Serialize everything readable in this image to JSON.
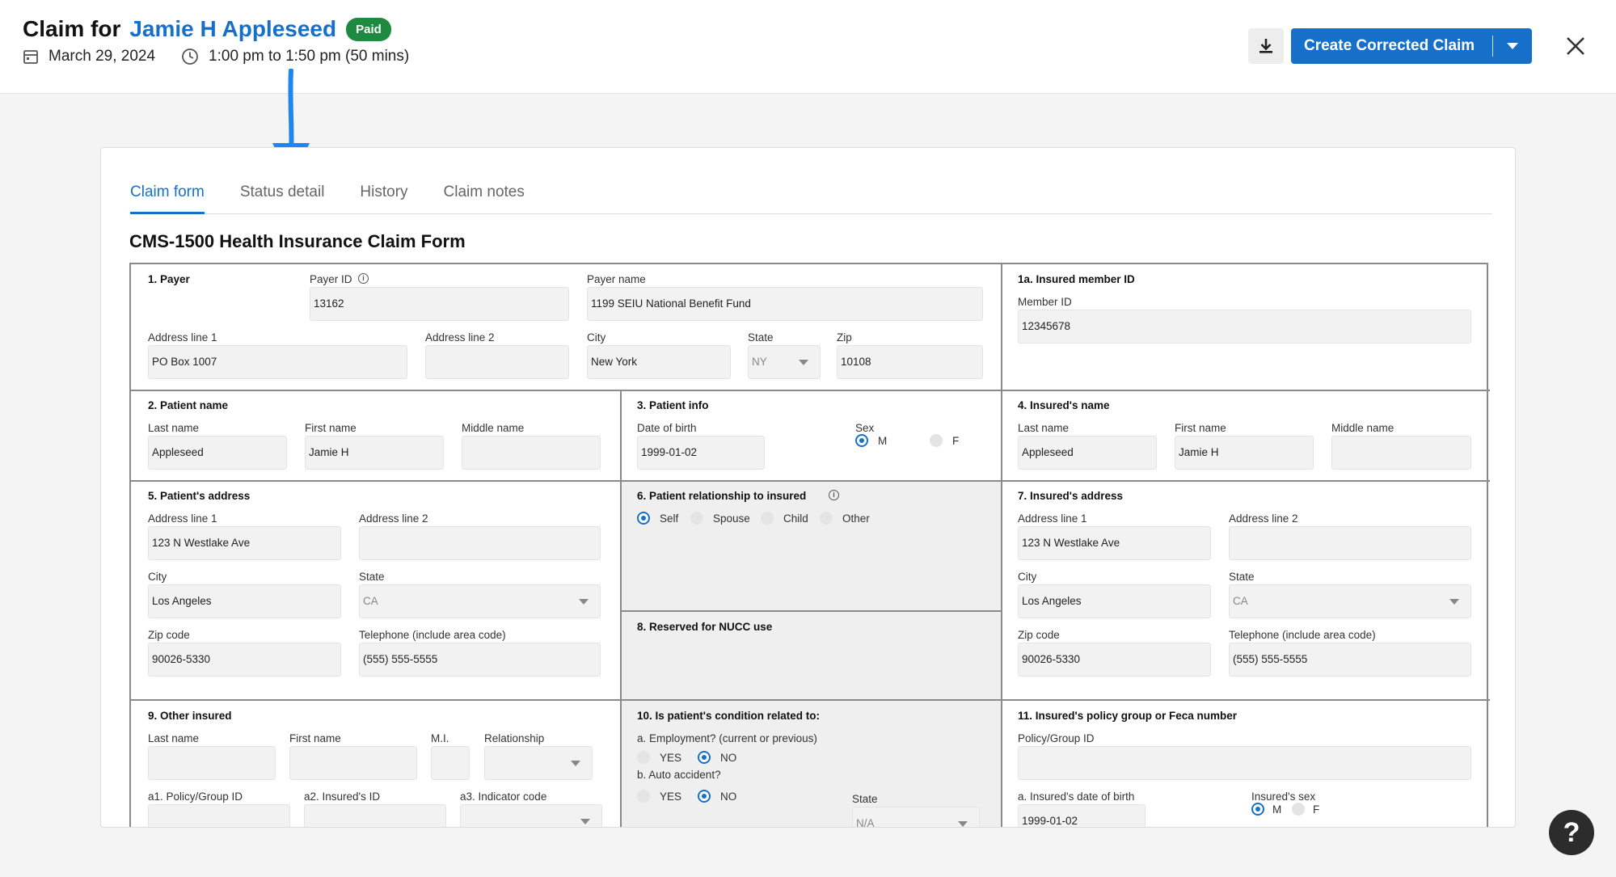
{
  "header": {
    "title_prefix": "Claim for",
    "patient_name": "Jamie H Appleseed",
    "status_badge": "Paid",
    "date": "March 29, 2024",
    "time": "1:00 pm to 1:50 pm (50 mins)",
    "primary_action": "Create Corrected Claim"
  },
  "tabs": [
    "Claim form",
    "Status detail",
    "History",
    "Claim notes"
  ],
  "form_title": "CMS-1500 Health Insurance Claim Form",
  "form": {
    "payer": {
      "section": "1. Payer",
      "payer_id_label": "Payer ID",
      "payer_id": "13162",
      "payer_name_label": "Payer name",
      "payer_name": "1199 SEIU National Benefit Fund",
      "addr1_label": "Address line 1",
      "addr1": "PO Box 1007",
      "addr2_label": "Address line 2",
      "addr2": "",
      "city_label": "City",
      "city": "New York",
      "state_label": "State",
      "state": "NY",
      "zip_label": "Zip",
      "zip": "10108"
    },
    "insured_member": {
      "section": "1a. Insured member ID",
      "member_id_label": "Member ID",
      "member_id": "12345678"
    },
    "patient_name": {
      "section": "2. Patient name",
      "last_label": "Last name",
      "last": "Appleseed",
      "first_label": "First name",
      "first": "Jamie H",
      "middle_label": "Middle name",
      "middle": ""
    },
    "patient_info": {
      "section": "3. Patient info",
      "dob_label": "Date of birth",
      "dob": "1999-01-02",
      "sex_label": "Sex",
      "sex_m": "M",
      "sex_f": "F"
    },
    "insured_name": {
      "section": "4. Insured's name",
      "last_label": "Last name",
      "last": "Appleseed",
      "first_label": "First name",
      "first": "Jamie H",
      "middle_label": "Middle name",
      "middle": ""
    },
    "patient_address": {
      "section": "5. Patient's address",
      "addr1_label": "Address line 1",
      "addr1": "123 N Westlake Ave",
      "addr2_label": "Address line 2",
      "addr2": "",
      "city_label": "City",
      "city": "Los Angeles",
      "state_label": "State",
      "state": "CA",
      "zip_label": "Zip code",
      "zip": "90026-5330",
      "phone_label": "Telephone (include area code)",
      "phone": "(555) 555-5555"
    },
    "relationship": {
      "section": "6. Patient relationship to insured",
      "self": "Self",
      "spouse": "Spouse",
      "child": "Child",
      "other": "Other"
    },
    "insured_address": {
      "section": "7. Insured's address",
      "addr1_label": "Address line 1",
      "addr1": "123 N Westlake Ave",
      "addr2_label": "Address line 2",
      "addr2": "",
      "city_label": "City",
      "city": "Los Angeles",
      "state_label": "State",
      "state": "CA",
      "zip_label": "Zip code",
      "zip": "90026-5330",
      "phone_label": "Telephone (include area code)",
      "phone": "(555) 555-5555"
    },
    "reserved": {
      "section": "8. Reserved for NUCC use"
    },
    "other_insured": {
      "section": "9. Other insured",
      "last_label": "Last name",
      "first_label": "First name",
      "mi_label": "M.I.",
      "relationship_label": "Relationship",
      "policy_label": "a1. Policy/Group ID",
      "insured_id_label": "a2. Insured's ID",
      "indicator_label": "a3. Indicator code"
    },
    "condition": {
      "section": "10. Is patient's condition related to:",
      "employment_label": "a. Employment? (current or previous)",
      "auto_label": "b. Auto accident?",
      "yes": "YES",
      "no": "NO",
      "state_label": "State",
      "state": "N/A"
    },
    "policy_group": {
      "section": "11. Insured's policy group or Feca number",
      "policy_label": "Policy/Group ID",
      "policy": "",
      "dob_label": "a. Insured's date of birth",
      "dob": "1999-01-02",
      "sex_label": "Insured's sex",
      "sex_m": "M",
      "sex_f": "F"
    }
  },
  "help": "?"
}
